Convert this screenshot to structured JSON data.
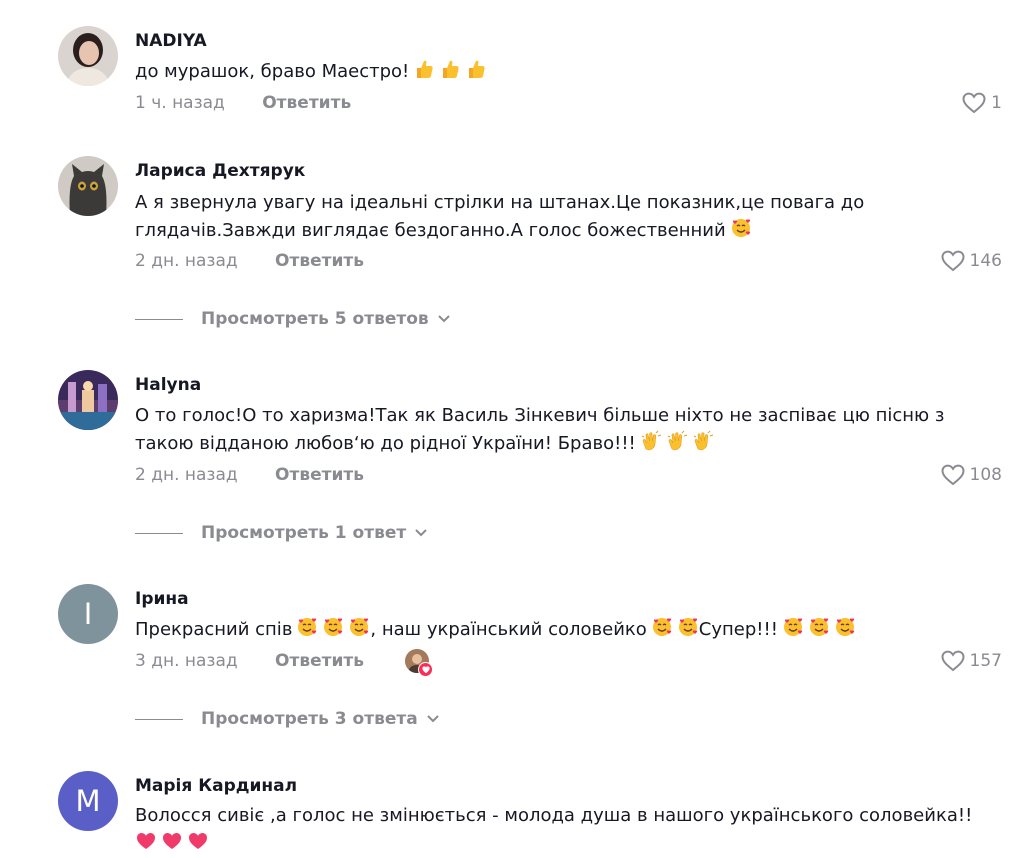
{
  "reply_label": "Ответить",
  "comments": [
    {
      "username": "NADIYA",
      "text": "до мурашок, браво Маестро!",
      "emojis": [
        "thumbs-up",
        "thumbs-up",
        "thumbs-up"
      ],
      "time": "1 ч. назад",
      "likes": "1"
    },
    {
      "username": "Лариса Дехтярук",
      "text_line1": "А я звернула увагу на ідеальні стрілки на штанах.Це показник,це повага до",
      "text_line2": "глядачів.Завжди виглядає бездоганно.А голос божественний",
      "emojis": [
        "smiling-face-with-hearts"
      ],
      "time": "2 дн. назад",
      "likes": "146",
      "view_replies": "Просмотреть 5 ответов"
    },
    {
      "username": "Halyna",
      "text_line1": "О то голос!О то харизма!Так як Василь Зінкевич більше ніхто не заспіває цю пісню з",
      "text_line2": "такою відданою любов‘ю до рідної України! Браво!!!",
      "emojis": [
        "clapping-hands",
        "clapping-hands",
        "clapping-hands"
      ],
      "time": "2 дн. назад",
      "likes": "108",
      "view_replies": "Просмотреть 1 ответ"
    },
    {
      "username": "Ірина",
      "avatar_letter": "I",
      "text_part1": "Прекрасний спів",
      "text_part2": ", наш український соловейко",
      "text_part3": "Супер!!!",
      "time": "3 дн. назад",
      "likes": "157",
      "view_replies": "Просмотреть 3 ответа"
    },
    {
      "username": "Марія Кардинал",
      "avatar_letter": "M",
      "text": "Волосся сивіє ,а голос не змінюється - молода душа в нашого українського соловейка!!",
      "emojis": [
        "heart",
        "heart",
        "heart"
      ]
    }
  ],
  "colors": {
    "text": "#161823",
    "muted": "#8a8b91",
    "avatar_irina": "#7f939c",
    "avatar_maria": "#5a5fc7",
    "like_badge": "#fe2c55"
  }
}
